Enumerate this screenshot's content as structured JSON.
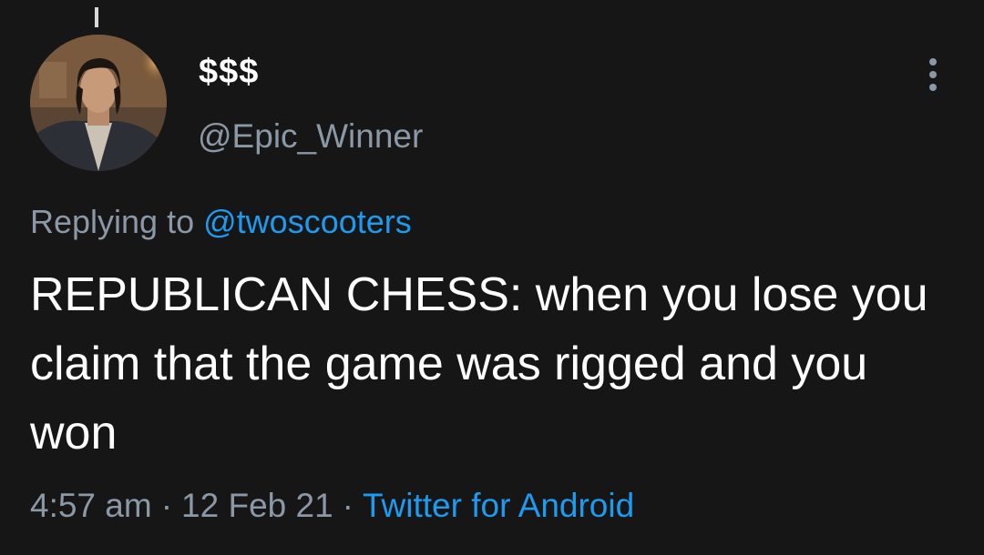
{
  "tweet": {
    "display_name": "$$$",
    "handle": "@Epic_Winner",
    "replying_prefix": "Replying to",
    "replying_to": "@twoscooters",
    "text": "REPUBLICAN CHESS: when you lose you claim that the game was rigged and you won",
    "time": "4:57 am",
    "date": "12 Feb 21",
    "source": "Twitter for Android",
    "separator": "·"
  },
  "icons": {
    "more": "more-vertical-icon",
    "avatar": "profile-photo"
  },
  "colors": {
    "background": "#161616",
    "text_primary": "#ffffff",
    "text_secondary": "#8b98a5",
    "accent": "#1d9bf0"
  }
}
